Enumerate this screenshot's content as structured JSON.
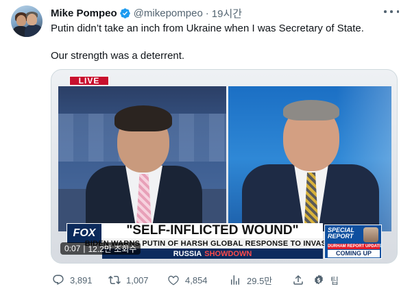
{
  "tweet": {
    "author_name": "Mike Pompeo",
    "handle": "@mikepompeo",
    "dot": "·",
    "time": "19시간",
    "text_line1": "Putin didn’t take an inch from Ukraine when I was Secretary of State.",
    "text_line2": "Our strength was a deterrent."
  },
  "video": {
    "live_label": "LIVE",
    "network_logo": "FOX",
    "headline": "\"SELF-INFLICTED WOUND\"",
    "subline": "BIDEN WARNS PUTIN OF HARSH GLOBAL RESPONSE TO INVASION",
    "ticker_word1": "RUSSIA",
    "ticker_word2": "SHOWDOWN",
    "special_report": "SPECIAL REPORT",
    "durham_update": "DURHAM REPORT UPDATE",
    "coming_up": "COMING UP",
    "elapsed": "0:07",
    "views": "12.2만 조회수"
  },
  "actions": {
    "replies": "3,891",
    "retweets": "1,007",
    "likes": "4,854",
    "views": "29.5만",
    "tip_label": "팁"
  },
  "colors": {
    "verified_blue": "#1d9bf0",
    "secondary_text": "#536471",
    "live_red": "#c8102e",
    "fox_navy": "#0c2b5e"
  },
  "icons": [
    "verified-badge-icon",
    "more-icon",
    "reply-icon",
    "retweet-icon",
    "like-icon",
    "views-icon",
    "share-icon",
    "tip-icon"
  ]
}
